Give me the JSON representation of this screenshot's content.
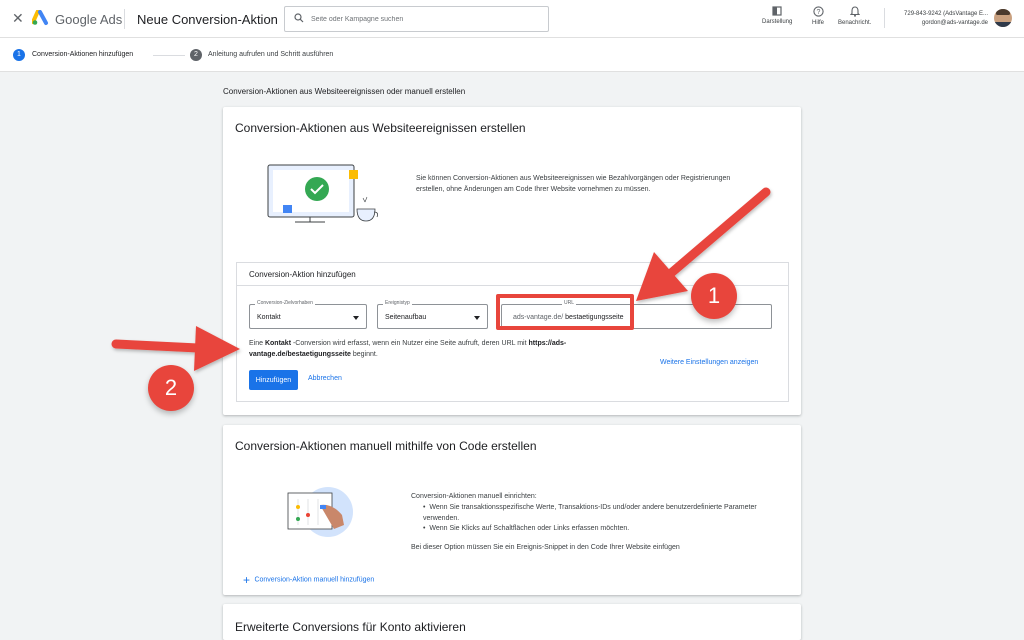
{
  "header": {
    "close_icon": "close-icon",
    "brand": "Google Ads",
    "title": "Neue Conversion-Aktion",
    "search_placeholder": "Seite oder Kampagne suchen",
    "display_label": "Darstellung",
    "help_label": "Hilfe",
    "notifications_label": "Benachricht.",
    "account_line1": "729-843-9242 (AdsVantage E...",
    "account_line2": "gordon@ads-vantage.de"
  },
  "stepper": {
    "steps": [
      {
        "number": "1",
        "label": "Conversion-Aktionen hinzufügen",
        "active": true
      },
      {
        "number": "2",
        "label": "Anleitung aufrufen und Schritt ausführen",
        "active": false
      }
    ]
  },
  "main": {
    "section_heading": "Conversion-Aktionen aus Websiteereignissen oder manuell erstellen",
    "website_card": {
      "title": "Conversion-Aktionen aus Websiteereignissen erstellen",
      "description": "Sie können Conversion-Aktionen aus Websiteereignissen wie Bezahlvorgängen oder Registrierungen erstellen, ohne Änderungen am Code Ihrer Website vornehmen zu müssen.",
      "form": {
        "title": "Conversion-Aktion hinzufügen",
        "goal_label": "Conversion-Zielvorhaben",
        "goal_value": "Kontakt",
        "event_label": "Ereignistyp",
        "event_value": "Seitenaufbau",
        "url_label": "URL",
        "url_prefix": "ads-vantage.de/",
        "url_value": "bestaetigungsseite",
        "info_pre": "Eine ",
        "info_bold1": "Kontakt",
        "info_mid": " -Conversion wird erfasst, wenn ein Nutzer eine Seite aufruft, deren URL mit ",
        "info_bold2": "https://ads-vantage.de/bestaetigungsseite",
        "info_post": " beginnt.",
        "more_settings": "Weitere Einstellungen anzeigen",
        "add_button": "Hinzufügen",
        "cancel_button": "Abbrechen"
      }
    },
    "manual_card": {
      "title": "Conversion-Aktionen manuell mithilfe von Code erstellen",
      "intro": "Conversion-Aktionen manuell einrichten:",
      "bullets": [
        "Wenn Sie transaktionsspezifische Werte, Transaktions-IDs und/oder andere benutzerdefinierte Parameter verwenden.",
        "Wenn Sie Klicks auf Schaltflächen oder Links erfassen möchten."
      ],
      "note": "Bei dieser Option müssen Sie ein Ereignis-Snippet in den Code Ihrer Website einfügen",
      "add_link": "Conversion-Aktion manuell hinzufügen"
    },
    "enhanced_card": {
      "title": "Erweiterte Conversions für Konto aktivieren"
    }
  },
  "annotations": {
    "badge1": "1",
    "badge2": "2"
  },
  "colors": {
    "accent": "#1a73e8",
    "annotation_red": "#e8453c",
    "success_green": "#34a853"
  }
}
